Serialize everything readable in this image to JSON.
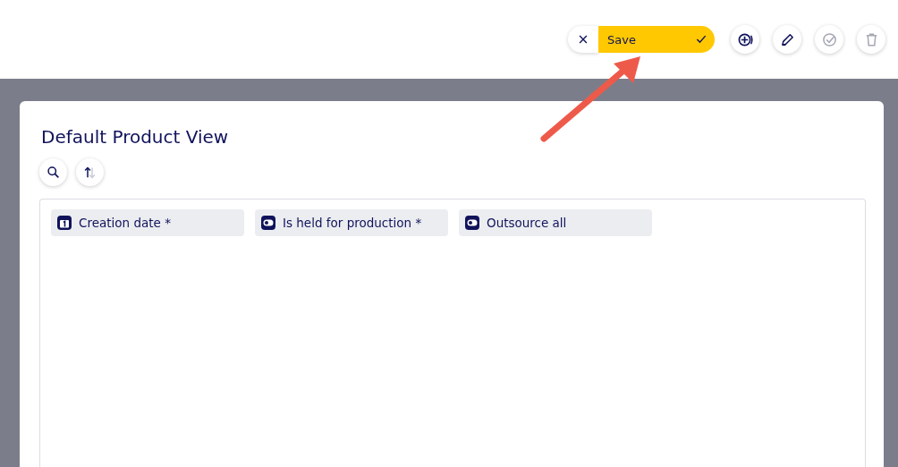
{
  "toolbar": {
    "save": {
      "label": "Save"
    },
    "actions": [
      {
        "kind": "add",
        "disabled": false
      },
      {
        "kind": "edit",
        "disabled": false
      },
      {
        "kind": "validate",
        "disabled": true
      },
      {
        "kind": "delete",
        "disabled": true
      }
    ]
  },
  "view": {
    "title": "Default Product View",
    "tools": [
      {
        "kind": "search"
      },
      {
        "kind": "sort"
      }
    ],
    "fields": [
      {
        "kind": "date",
        "label": "Creation date *"
      },
      {
        "kind": "toggle",
        "label": "Is held for production *"
      },
      {
        "kind": "toggle",
        "label": "Outsource all"
      }
    ]
  }
}
